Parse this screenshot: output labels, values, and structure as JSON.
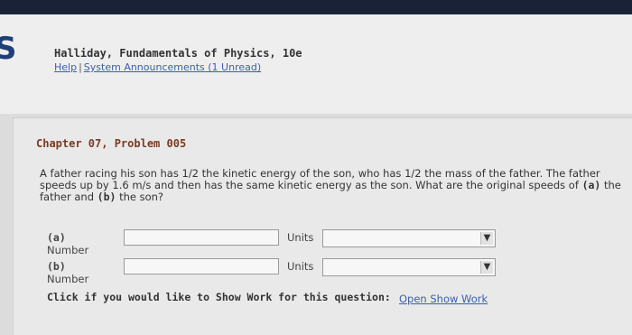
{
  "header": {
    "logo_text": "S",
    "book_title": "Halliday, Fundamentals of Physics, 10e",
    "help_link": "Help",
    "separator": "|",
    "announcements_link": "System Announcements (1 Unread)"
  },
  "problem": {
    "title": "Chapter 07, Problem 005",
    "question_pre": "A father racing his son has 1/2 the kinetic energy of the son, who has 1/2 the mass of the father. The father speeds up by 1.6 m/s and then has the same kinetic energy as the son. What are the original speeds of ",
    "part_a_marker": "(a)",
    "question_mid": " the father and ",
    "part_b_marker": "(b)",
    "question_post": " the son?"
  },
  "answers": {
    "a": {
      "marker": "(a)",
      "label": "Number",
      "value": "",
      "units_label": "Units",
      "units_value": ""
    },
    "b": {
      "marker": "(b)",
      "label": "Number",
      "value": "",
      "units_label": "Units",
      "units_value": ""
    }
  },
  "showwork": {
    "prompt": "Click if you would like to Show Work for this question:",
    "link": "Open Show Work"
  },
  "colors": {
    "topbar": "#1a2238",
    "logo": "#1f3f7a",
    "problem_title": "#7a3a22",
    "link": "#3a5fb0"
  },
  "icons": {
    "dropdown": "chevron-down-icon"
  }
}
